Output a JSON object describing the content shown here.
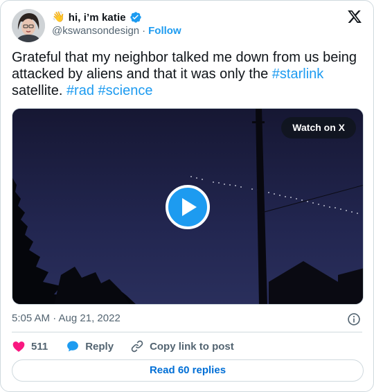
{
  "author": {
    "emoji": "👋",
    "display_name": "hi, i’m katie",
    "handle": "@kswansondesign",
    "separator": "·",
    "follow_label": "Follow",
    "verified_color": "#1d9bf0"
  },
  "tweet": {
    "text_parts": [
      {
        "text": "Grateful that my neighbor talked me down from us being attacked by aliens and that it was only the ",
        "type": "text"
      },
      {
        "text": "#starlink",
        "type": "hashtag"
      },
      {
        "text": " satellite. ",
        "type": "text"
      },
      {
        "text": "#rad",
        "type": "hashtag"
      },
      {
        "text": " ",
        "type": "text"
      },
      {
        "text": "#science",
        "type": "hashtag"
      }
    ]
  },
  "media": {
    "watch_label": "Watch on X",
    "play_icon": "play-icon"
  },
  "meta": {
    "timestamp": "5:05 AM · Aug 21, 2022",
    "info_icon": "info-icon"
  },
  "actions": {
    "likes_count": "511",
    "reply_label": "Reply",
    "copy_link_label": "Copy link to post"
  },
  "footer": {
    "read_replies_label": "Read 60 replies"
  },
  "colors": {
    "accent": "#1d9bf0",
    "like": "#f91880",
    "muted": "#536471",
    "link": "#006fd6"
  }
}
